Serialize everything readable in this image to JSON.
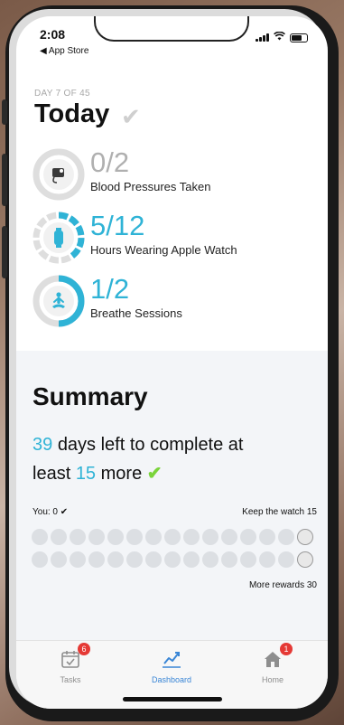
{
  "status_bar": {
    "time": "2:08",
    "back_app": "◀ App Store"
  },
  "today": {
    "day_label": "DAY 7 OF 45",
    "title": "Today",
    "metrics": [
      {
        "value": "0/2",
        "label": "Blood Pressures Taken",
        "color": "#b6b6b6",
        "icon": "blood-pressure-icon"
      },
      {
        "value": "5/12",
        "label": "Hours Wearing Apple Watch",
        "color": "#2fb3d6",
        "icon": "apple-watch-icon"
      },
      {
        "value": "1/2",
        "label": "Breathe Sessions",
        "color": "#2fb3d6",
        "icon": "breathe-icon"
      }
    ]
  },
  "summary": {
    "title": "Summary",
    "days_left": "39",
    "line1_text": "days left to complete at",
    "line2_prefix": "least",
    "more_count": "15",
    "line2_suffix": "more",
    "you_label": "You: 0 ✔",
    "keep_label": "Keep the watch  15",
    "more_rewards_label": "More rewards  30"
  },
  "tabbar": {
    "tasks": {
      "label": "Tasks",
      "badge": "6"
    },
    "dashboard": {
      "label": "Dashboard"
    },
    "home": {
      "label": "Home",
      "badge": "1"
    }
  },
  "colors": {
    "accent": "#2fb3d6",
    "check_green": "#7ad43b",
    "badge_red": "#e53935",
    "active_tab": "#3a86d6"
  }
}
